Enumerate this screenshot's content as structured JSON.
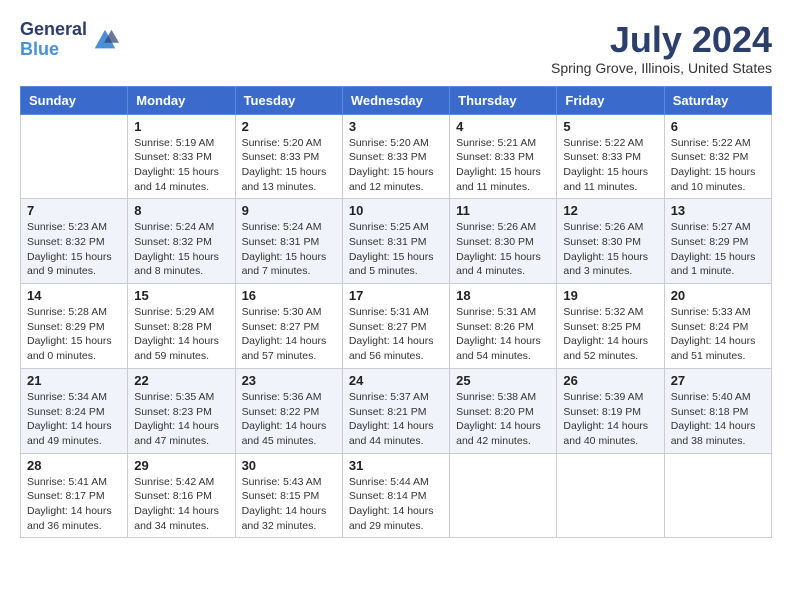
{
  "logo": {
    "general": "General",
    "blue": "Blue"
  },
  "title": "July 2024",
  "location": "Spring Grove, Illinois, United States",
  "days_of_week": [
    "Sunday",
    "Monday",
    "Tuesday",
    "Wednesday",
    "Thursday",
    "Friday",
    "Saturday"
  ],
  "weeks": [
    [
      {
        "day": "",
        "detail": ""
      },
      {
        "day": "1",
        "detail": "Sunrise: 5:19 AM\nSunset: 8:33 PM\nDaylight: 15 hours\nand 14 minutes."
      },
      {
        "day": "2",
        "detail": "Sunrise: 5:20 AM\nSunset: 8:33 PM\nDaylight: 15 hours\nand 13 minutes."
      },
      {
        "day": "3",
        "detail": "Sunrise: 5:20 AM\nSunset: 8:33 PM\nDaylight: 15 hours\nand 12 minutes."
      },
      {
        "day": "4",
        "detail": "Sunrise: 5:21 AM\nSunset: 8:33 PM\nDaylight: 15 hours\nand 11 minutes."
      },
      {
        "day": "5",
        "detail": "Sunrise: 5:22 AM\nSunset: 8:33 PM\nDaylight: 15 hours\nand 11 minutes."
      },
      {
        "day": "6",
        "detail": "Sunrise: 5:22 AM\nSunset: 8:32 PM\nDaylight: 15 hours\nand 10 minutes."
      }
    ],
    [
      {
        "day": "7",
        "detail": "Sunrise: 5:23 AM\nSunset: 8:32 PM\nDaylight: 15 hours\nand 9 minutes."
      },
      {
        "day": "8",
        "detail": "Sunrise: 5:24 AM\nSunset: 8:32 PM\nDaylight: 15 hours\nand 8 minutes."
      },
      {
        "day": "9",
        "detail": "Sunrise: 5:24 AM\nSunset: 8:31 PM\nDaylight: 15 hours\nand 7 minutes."
      },
      {
        "day": "10",
        "detail": "Sunrise: 5:25 AM\nSunset: 8:31 PM\nDaylight: 15 hours\nand 5 minutes."
      },
      {
        "day": "11",
        "detail": "Sunrise: 5:26 AM\nSunset: 8:30 PM\nDaylight: 15 hours\nand 4 minutes."
      },
      {
        "day": "12",
        "detail": "Sunrise: 5:26 AM\nSunset: 8:30 PM\nDaylight: 15 hours\nand 3 minutes."
      },
      {
        "day": "13",
        "detail": "Sunrise: 5:27 AM\nSunset: 8:29 PM\nDaylight: 15 hours\nand 1 minute."
      }
    ],
    [
      {
        "day": "14",
        "detail": "Sunrise: 5:28 AM\nSunset: 8:29 PM\nDaylight: 15 hours\nand 0 minutes."
      },
      {
        "day": "15",
        "detail": "Sunrise: 5:29 AM\nSunset: 8:28 PM\nDaylight: 14 hours\nand 59 minutes."
      },
      {
        "day": "16",
        "detail": "Sunrise: 5:30 AM\nSunset: 8:27 PM\nDaylight: 14 hours\nand 57 minutes."
      },
      {
        "day": "17",
        "detail": "Sunrise: 5:31 AM\nSunset: 8:27 PM\nDaylight: 14 hours\nand 56 minutes."
      },
      {
        "day": "18",
        "detail": "Sunrise: 5:31 AM\nSunset: 8:26 PM\nDaylight: 14 hours\nand 54 minutes."
      },
      {
        "day": "19",
        "detail": "Sunrise: 5:32 AM\nSunset: 8:25 PM\nDaylight: 14 hours\nand 52 minutes."
      },
      {
        "day": "20",
        "detail": "Sunrise: 5:33 AM\nSunset: 8:24 PM\nDaylight: 14 hours\nand 51 minutes."
      }
    ],
    [
      {
        "day": "21",
        "detail": "Sunrise: 5:34 AM\nSunset: 8:24 PM\nDaylight: 14 hours\nand 49 minutes."
      },
      {
        "day": "22",
        "detail": "Sunrise: 5:35 AM\nSunset: 8:23 PM\nDaylight: 14 hours\nand 47 minutes."
      },
      {
        "day": "23",
        "detail": "Sunrise: 5:36 AM\nSunset: 8:22 PM\nDaylight: 14 hours\nand 45 minutes."
      },
      {
        "day": "24",
        "detail": "Sunrise: 5:37 AM\nSunset: 8:21 PM\nDaylight: 14 hours\nand 44 minutes."
      },
      {
        "day": "25",
        "detail": "Sunrise: 5:38 AM\nSunset: 8:20 PM\nDaylight: 14 hours\nand 42 minutes."
      },
      {
        "day": "26",
        "detail": "Sunrise: 5:39 AM\nSunset: 8:19 PM\nDaylight: 14 hours\nand 40 minutes."
      },
      {
        "day": "27",
        "detail": "Sunrise: 5:40 AM\nSunset: 8:18 PM\nDaylight: 14 hours\nand 38 minutes."
      }
    ],
    [
      {
        "day": "28",
        "detail": "Sunrise: 5:41 AM\nSunset: 8:17 PM\nDaylight: 14 hours\nand 36 minutes."
      },
      {
        "day": "29",
        "detail": "Sunrise: 5:42 AM\nSunset: 8:16 PM\nDaylight: 14 hours\nand 34 minutes."
      },
      {
        "day": "30",
        "detail": "Sunrise: 5:43 AM\nSunset: 8:15 PM\nDaylight: 14 hours\nand 32 minutes."
      },
      {
        "day": "31",
        "detail": "Sunrise: 5:44 AM\nSunset: 8:14 PM\nDaylight: 14 hours\nand 29 minutes."
      },
      {
        "day": "",
        "detail": ""
      },
      {
        "day": "",
        "detail": ""
      },
      {
        "day": "",
        "detail": ""
      }
    ]
  ]
}
